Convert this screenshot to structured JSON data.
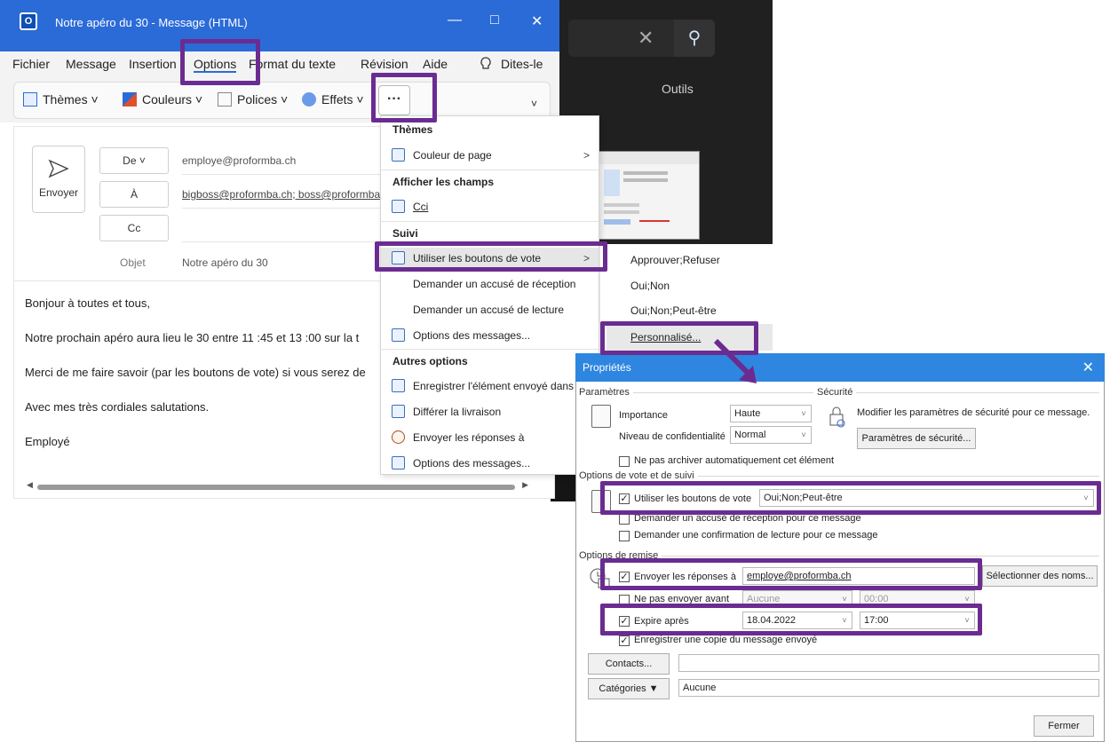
{
  "outlook": {
    "title": "Notre apéro du 30  -  Message (HTML)",
    "logo": "O",
    "win_min": "—",
    "win_max": "□",
    "win_close": "✕",
    "menu": {
      "fichier": "Fichier",
      "message": "Message",
      "insertion": "Insertion",
      "options": "Options",
      "format": "Format du texte",
      "revision": "Révision",
      "aide": "Aide",
      "dites": "Dites-le"
    },
    "ribbon": {
      "themes": "Thèmes ˅",
      "couleurs": "Couleurs ˅",
      "polices": "Polices ˅",
      "effets": "Effets ˅",
      "more": "···",
      "expand": "˅"
    },
    "compose": {
      "send": "Envoyer",
      "de": "De ˅",
      "a": "À",
      "cc": "Cc",
      "objet_label": "Objet",
      "from_value": "employe@proformba.ch",
      "to_value": "bigboss@proformba.ch; boss@proformba",
      "subject_value": "Notre apéro du 30"
    },
    "body_lines": [
      "Bonjour à toutes et tous,",
      "Notre prochain apéro aura lieu le 30 entre 11 :45 et 13 :00 sur la t",
      "Merci de me faire savoir (par les boutons de vote) si vous serez de",
      "Avec mes très cordiales salutations.",
      "Employé"
    ]
  },
  "dark_window": {
    "outils": "Outils",
    "close": "✕",
    "search": "⚲"
  },
  "dropdown": {
    "header_themes": "Thèmes",
    "couleur_page": "Couleur de page",
    "header_champs": "Afficher les champs",
    "cci": "Cci",
    "header_suivi": "Suivi",
    "vote": "Utiliser les boutons de vote",
    "accuse_reception": "Demander un accusé de réception",
    "accuse_lecture": "Demander un accusé de lecture",
    "options_messages": "Options des messages...",
    "header_autres": "Autres options",
    "enregistrer": "Enregistrer l'élément envoyé dans",
    "differer": "Différer la livraison",
    "envoyer_reponses": "Envoyer les réponses à",
    "options_messages_2": "Options des messages..."
  },
  "submenu": {
    "items": [
      "Approuver;Refuser",
      "Oui;Non",
      "Oui;Non;Peut-être",
      "Personnalisé..."
    ]
  },
  "dialog": {
    "title": "Propriétés",
    "close": "✕",
    "parametres": "Paramètres",
    "securite": "Sécurité",
    "importance_label": "Importance",
    "importance_value": "Haute",
    "confidentialite_label": "Niveau de confidentialité",
    "confidentialite_value": "Normal",
    "securite_text": "Modifier les paramètres de sécurité pour ce message.",
    "securite_button": "Paramètres de sécurité...",
    "ne_pas_archiver": "Ne pas archiver automatiquement cet élément",
    "vote_group": "Options de vote et de suivi",
    "utiliser_vote": "Utiliser les boutons de vote",
    "vote_value": "Oui;Non;Peut-être",
    "accuse_reception": "Demander un accusé de réception pour ce message",
    "confirmation_lecture": "Demander une confirmation de lecture pour ce message",
    "remise_group": "Options de remise",
    "envoyer_reponses": "Envoyer les réponses à",
    "reponses_value": "employe@proformba.ch",
    "selectionner_noms": "Sélectionner des noms...",
    "ne_pas_envoyer": "Ne pas envoyer avant",
    "ne_pas_envoyer_date": "Aucune",
    "ne_pas_envoyer_heure": "00:00",
    "expire_apres": "Expire après",
    "expire_date": "18.04.2022",
    "expire_heure": "17:00",
    "enregistrer_copie": "Enregistrer une copie du message envoyé",
    "contacts_button": "Contacts...",
    "categories_button": "Catégories ▼",
    "categories_value": "Aucune",
    "fermer": "Fermer",
    "checked_mark": "✓"
  }
}
